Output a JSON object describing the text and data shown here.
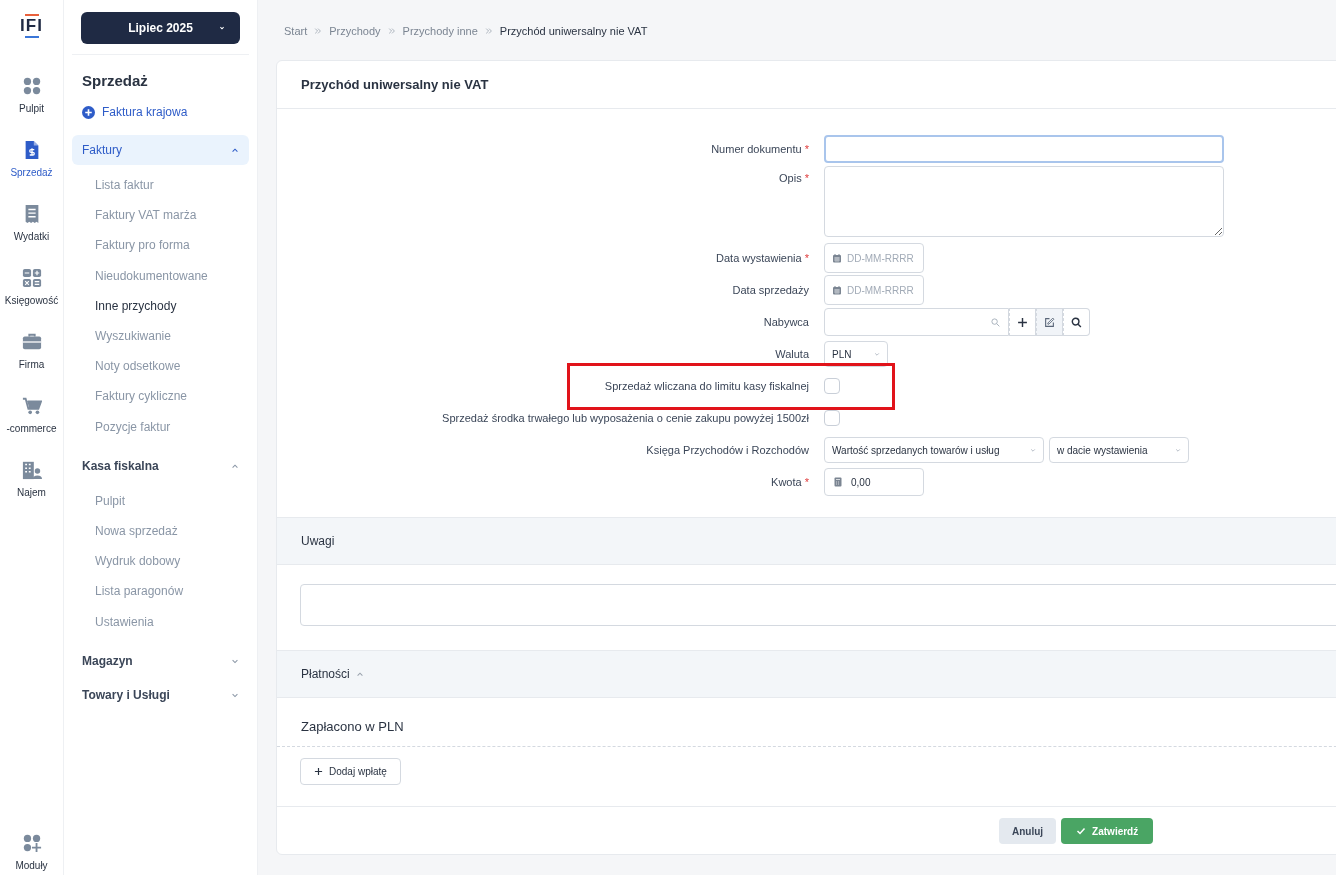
{
  "rail": {
    "logo": "IFI",
    "items": [
      {
        "label": "Pulpit",
        "selected": false
      },
      {
        "label": "Sprzedaż",
        "selected": true
      },
      {
        "label": "Wydatki",
        "selected": false
      },
      {
        "label": "Księgowość",
        "selected": false
      },
      {
        "label": "Firma",
        "selected": false
      },
      {
        "label": "-commerce",
        "selected": false
      },
      {
        "label": "Najem",
        "selected": false
      }
    ],
    "bottom": {
      "label": "Moduły"
    }
  },
  "sidebar": {
    "period": "Lipiec 2025",
    "title": "Sprzedaż",
    "action": "Faktura krajowa",
    "groups": [
      {
        "label": "Faktury",
        "selected": true,
        "expanded": true,
        "children": [
          {
            "label": "Lista faktur",
            "selected": false
          },
          {
            "label": "Faktury VAT marża",
            "selected": false
          },
          {
            "label": "Faktury pro forma",
            "selected": false
          },
          {
            "label": "Nieudokumentowane",
            "selected": false
          },
          {
            "label": "Inne przychody",
            "selected": true
          },
          {
            "label": "Wyszukiwanie",
            "selected": false
          },
          {
            "label": "Noty odsetkowe",
            "selected": false
          },
          {
            "label": "Faktury cykliczne",
            "selected": false
          },
          {
            "label": "Pozycje faktur",
            "selected": false
          }
        ]
      },
      {
        "label": "Kasa fiskalna",
        "selected": false,
        "expanded": true,
        "children": [
          {
            "label": "Pulpit",
            "selected": false
          },
          {
            "label": "Nowa sprzedaż",
            "selected": false
          },
          {
            "label": "Wydruk dobowy",
            "selected": false
          },
          {
            "label": "Lista paragonów",
            "selected": false
          },
          {
            "label": "Ustawienia",
            "selected": false
          }
        ]
      },
      {
        "label": "Magazyn",
        "selected": false,
        "expanded": false
      },
      {
        "label": "Towary i Usługi",
        "selected": false,
        "expanded": false
      }
    ]
  },
  "breadcrumb": [
    "Start",
    "Przychody",
    "Przychody inne",
    "Przychód uniwersalny nie VAT"
  ],
  "form": {
    "title": "Przychód uniwersalny nie VAT",
    "fields": [
      {
        "kind": "text",
        "label": "Numer dokumentu",
        "required_mark": "*",
        "focused": true
      },
      {
        "kind": "textarea",
        "label": "Opis",
        "required_mark": "*"
      },
      {
        "kind": "date",
        "label": "Data wystawienia",
        "required_mark": "*",
        "placeholder": "DD-MM-RRRR"
      },
      {
        "kind": "date",
        "label": "Data sprzedaży",
        "placeholder": "DD-MM-RRRR"
      },
      {
        "kind": "lookup",
        "label": "Nabywca"
      },
      {
        "kind": "select",
        "label": "Waluta",
        "values": [
          "PLN"
        ]
      },
      {
        "kind": "checkbox",
        "label": "Sprzedaż wliczana do limitu kasy fiskalnej",
        "checked": false,
        "highlighted": true
      },
      {
        "kind": "checkbox",
        "label": "Sprzedaż środka trwałego lub wyposażenia o cenie zakupu powyżej 1500zł",
        "checked": false,
        "highlighted": false
      },
      {
        "kind": "select",
        "label": "Księga Przychodów i Rozchodów",
        "values": [
          "Wartość sprzedanych towarów i usług",
          "w dacie wystawienia"
        ]
      },
      {
        "kind": "amount",
        "label": "Kwota",
        "required_mark": "*",
        "value": "0,00"
      }
    ]
  },
  "remarks": {
    "title": "Uwagi"
  },
  "payments": {
    "title": "Płatności",
    "expanded": true,
    "subtitle": "Zapłacono w PLN",
    "add_button": "Dodaj wpłatę"
  },
  "footer": {
    "buttons": [
      {
        "label": "Anuluj",
        "kind": "secondary"
      },
      {
        "label": "Zatwierdź",
        "kind": "primary"
      }
    ]
  }
}
